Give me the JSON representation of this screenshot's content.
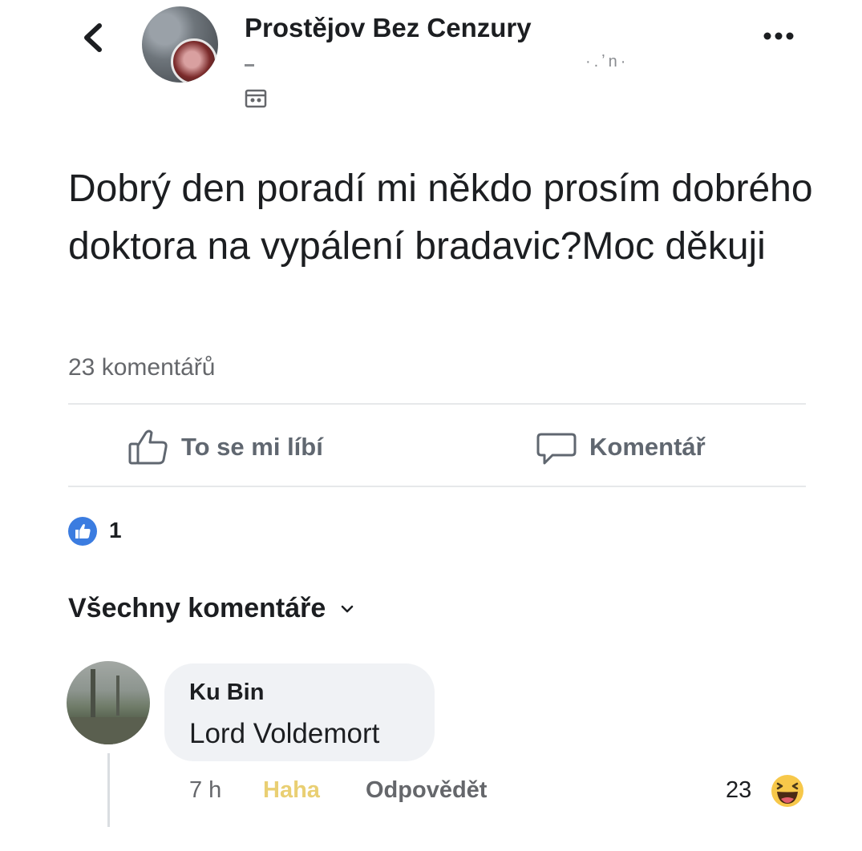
{
  "header": {
    "group_name": "Prostějov Bez Cenzury",
    "time_text": "·.ʼn·",
    "icons": [
      "back-arrow-icon",
      "group-avatar",
      "privacy-icon",
      "more-options-icon"
    ]
  },
  "post": {
    "text": "Dobrý den poradí mi někdo prosím dobrého doktora na vypálení bradavic?Moc děkuji",
    "comment_count": "23 komentářů",
    "reaction_count": "1"
  },
  "actions": {
    "like_label": "To se mi líbí",
    "comment_label": "Komentář"
  },
  "comments_section": {
    "filter_label": "Všechny komentáře",
    "comments": [
      {
        "author": "Ku Bin",
        "text": "Lord Voldemort",
        "time": "7 h",
        "reaction_action": "Haha",
        "reply_label": "Odpovědět",
        "reaction_count": "23"
      }
    ]
  },
  "colors": {
    "like_blue": "#3b7ce0",
    "haha_yellow": "#e9cf73",
    "bubble_bg": "#f0f2f5",
    "muted_text": "#65676b"
  }
}
